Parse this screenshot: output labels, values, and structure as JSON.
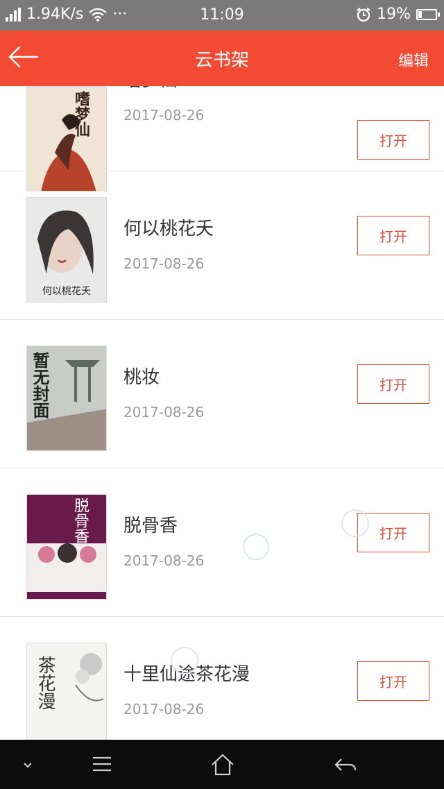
{
  "status_bar": {
    "network_speed": "1.94K/s",
    "more": "···",
    "time": "11:09",
    "battery_percent": "19%",
    "battery_level": 0.19
  },
  "header": {
    "title": "云书架",
    "edit_label": "编辑"
  },
  "books": [
    {
      "title": "嗜梦仙",
      "date": "2017-08-26",
      "open_label": "打开",
      "cover_text": "嗜梦仙"
    },
    {
      "title": "何以桃花夭",
      "date": "2017-08-26",
      "open_label": "打开",
      "cover_text": "何以桃花夭"
    },
    {
      "title": "桃妆",
      "date": "2017-08-26",
      "open_label": "打开",
      "cover_text": "暂无封面"
    },
    {
      "title": "脱骨香",
      "date": "2017-08-26",
      "open_label": "打开",
      "cover_text": "脱骨香"
    },
    {
      "title": "十里仙途茶花漫",
      "date": "2017-08-26",
      "open_label": "打开",
      "cover_text": "茶花漫"
    }
  ],
  "colors": {
    "accent": "#f24a33",
    "button_border": "#e0503f",
    "status_bar": "#7a7a7a",
    "nav_bar": "#0c0c0c"
  },
  "icons": {
    "back": "arrow-left-icon",
    "nav_down": "chevron-down-icon",
    "nav_menu": "menu-icon",
    "nav_home": "home-icon",
    "nav_back": "return-icon"
  }
}
